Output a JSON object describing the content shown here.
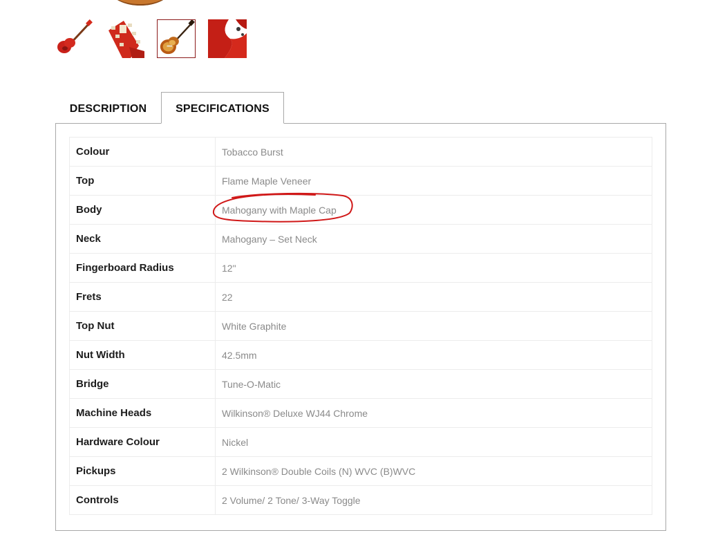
{
  "gallery": {
    "thumbnails": [
      {
        "name": "guitar-angled-red",
        "active": false
      },
      {
        "name": "headstock-red",
        "active": false
      },
      {
        "name": "guitar-front-tobacco-burst",
        "active": true
      },
      {
        "name": "body-closeup-red",
        "active": false
      }
    ]
  },
  "tabs": [
    {
      "label": "DESCRIPTION",
      "active": false
    },
    {
      "label": "SPECIFICATIONS",
      "active": true
    }
  ],
  "specifications": [
    {
      "label": "Colour",
      "value": "Tobacco Burst"
    },
    {
      "label": "Top",
      "value": "Flame Maple Veneer"
    },
    {
      "label": "Body",
      "value": "Mahogany with Maple Cap"
    },
    {
      "label": "Neck",
      "value": "Mahogany – Set Neck"
    },
    {
      "label": "Fingerboard Radius",
      "value": "12\""
    },
    {
      "label": "Frets",
      "value": "22"
    },
    {
      "label": "Top Nut",
      "value": "White Graphite"
    },
    {
      "label": "Nut Width",
      "value": "42.5mm"
    },
    {
      "label": "Bridge",
      "value": "Tune-O-Matic"
    },
    {
      "label": "Machine Heads",
      "value": "Wilkinson® Deluxe WJ44 Chrome"
    },
    {
      "label": "Hardware Colour",
      "value": "Nickel"
    },
    {
      "label": "Pickups",
      "value": "2 Wilkinson® Double Coils (N) WVC (B)WVC"
    },
    {
      "label": "Controls",
      "value": "2 Volume/ 2 Tone/ 3-Way Toggle"
    }
  ],
  "colors": {
    "tab_border": "#a8a8a8",
    "label_text": "#1c1c1c",
    "value_text": "#8a8a8a",
    "active_thumb_border": "#8b1a1a",
    "annotation": "#d01818"
  }
}
